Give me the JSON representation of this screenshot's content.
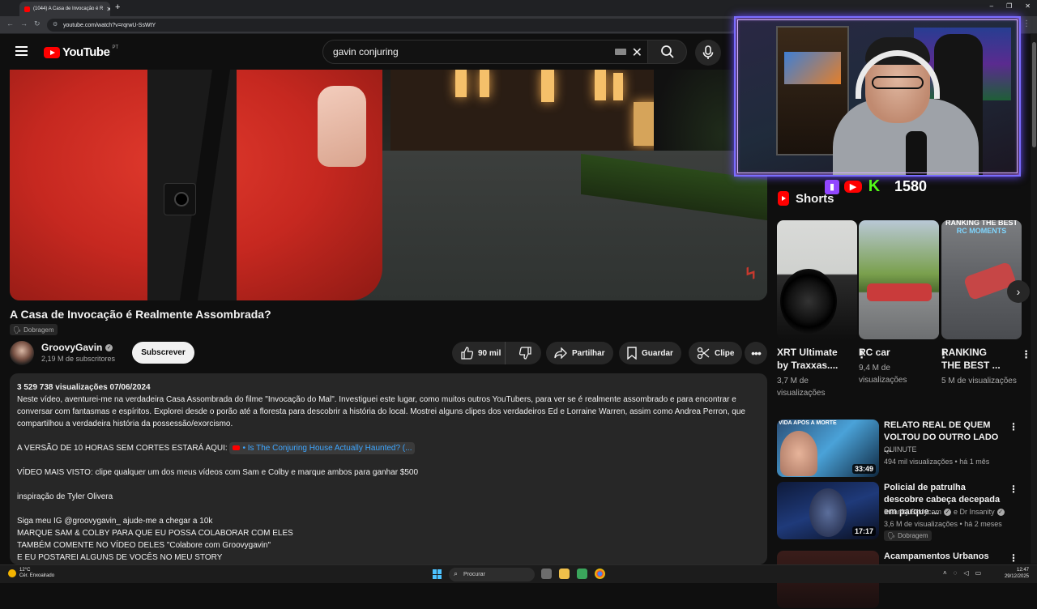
{
  "browser": {
    "tab_title": "(1044) A Casa de Invocação é R",
    "url": "youtube.com/watch?v=rqrwU-SsWtY",
    "tab_close": "✕",
    "new_tab": "+",
    "window_controls": [
      "–",
      "❐",
      "✕"
    ]
  },
  "header": {
    "logo_text": "YouTube",
    "country": "PT",
    "search_value": "gavin conjuring",
    "icons": [
      "menu-icon",
      "keyboard-icon",
      "clear-icon",
      "search-icon",
      "mic-icon"
    ]
  },
  "video": {
    "title": "A Casa de Invocação é Realmente Assombrada?",
    "dub_label": "Dobragem",
    "watermark": "ϟ"
  },
  "channel": {
    "name": "GroovyGavin",
    "verified_mark": "✓",
    "subscribers": "2,19 M de subscritores",
    "subscribe_label": "Subscrever"
  },
  "actions": {
    "likes": "90 mil",
    "share": "Partilhar",
    "save": "Guardar",
    "clip": "Clipe",
    "more": "•••"
  },
  "description": {
    "stats": "3 529 738 visualizações  07/06/2024",
    "p1": "Neste vídeo, aventurei-me na verdadeira Casa Assombrada do filme \"Invocação do Mal\". Investiguei este lugar, como muitos outros YouTubers, para ver se é realmente assombrado e para encontrar e conversar com fantasmas e espíritos. Explorei desde o porão até a floresta para descobrir a história do local. Mostrei alguns clipes dos verdadeiros Ed e Lorraine Warren, assim como Andrea Perron, que compartilhou a verdadeira história da possessão/exorcismo.",
    "ten_hours_prefix": "A VERSÃO DE 10 HORAS SEM CORTES ESTARÁ AQUI:",
    "ten_hours_link": "• Is The Conjuring House Actually Haunted? (...",
    "most_viewed": "VÍDEO MAIS VISTO: clipe qualquer um dos meus vídeos com Sam e Colby e marque ambos para ganhar $500",
    "inspiration": "inspiração de Tyler Olivera",
    "ig": "Siga meu IG @groovygavin_ ajude-me a chegar a 10k",
    "line_tag": "MARQUE SAM & COLBY PARA QUE EU POSSA COLABORAR COM ELES",
    "line_comment": "TAMBÉM COMENTE NO VÍDEO DELES \"Colabore com Groovygavin\"",
    "line_story": "E EU POSTAREI ALGUNS DE VOCÊS NO MEU STORY"
  },
  "overlay": {
    "follow_count": "1580",
    "kick_letter": "K"
  },
  "shorts": {
    "heading": "Shorts",
    "items": [
      {
        "title": "XRT Ultimate by Traxxas....",
        "views": "3,7 M de visualizações"
      },
      {
        "title": "RC car",
        "views": "9,4 M de visualizações"
      },
      {
        "title": "RANKING THE BEST ...",
        "views": "5 M de visualizações",
        "thumb_label": "RANKING THE BEST",
        "thumb_sub": "RC MOMENTS"
      }
    ]
  },
  "recommended": [
    {
      "title": "RELATO REAL DE QUEM VOLTOU DO OUTRO LADO ...",
      "channel": "QUINUTE",
      "meta": "494 mil visualizações • há 1 mês",
      "duration": "33:49",
      "thumb_caption": "VIDA APÓS A MORTE"
    },
    {
      "title": "Policial de patrulha descobre cabeça decepada em parque ...",
      "channel": "Insanity Bodycam",
      "channel2": "e Dr Insanity",
      "meta": "3,6 M de visualizações • há 2 meses",
      "duration": "17:17",
      "badge": "Dobragem"
    },
    {
      "title": "Acampamentos Urbanos Que"
    }
  ],
  "taskbar": {
    "temperature": "12°C",
    "weather": "Cér. Enxoalrado",
    "search_placeholder": "Procurar",
    "time": "12:47",
    "date": "29/12/2025"
  },
  "colors": {
    "accent_red": "#ff0000",
    "bg": "#0f0f0f",
    "surface": "#272727",
    "link": "#3ea6ff",
    "overlay_border": "#7a6cff"
  }
}
